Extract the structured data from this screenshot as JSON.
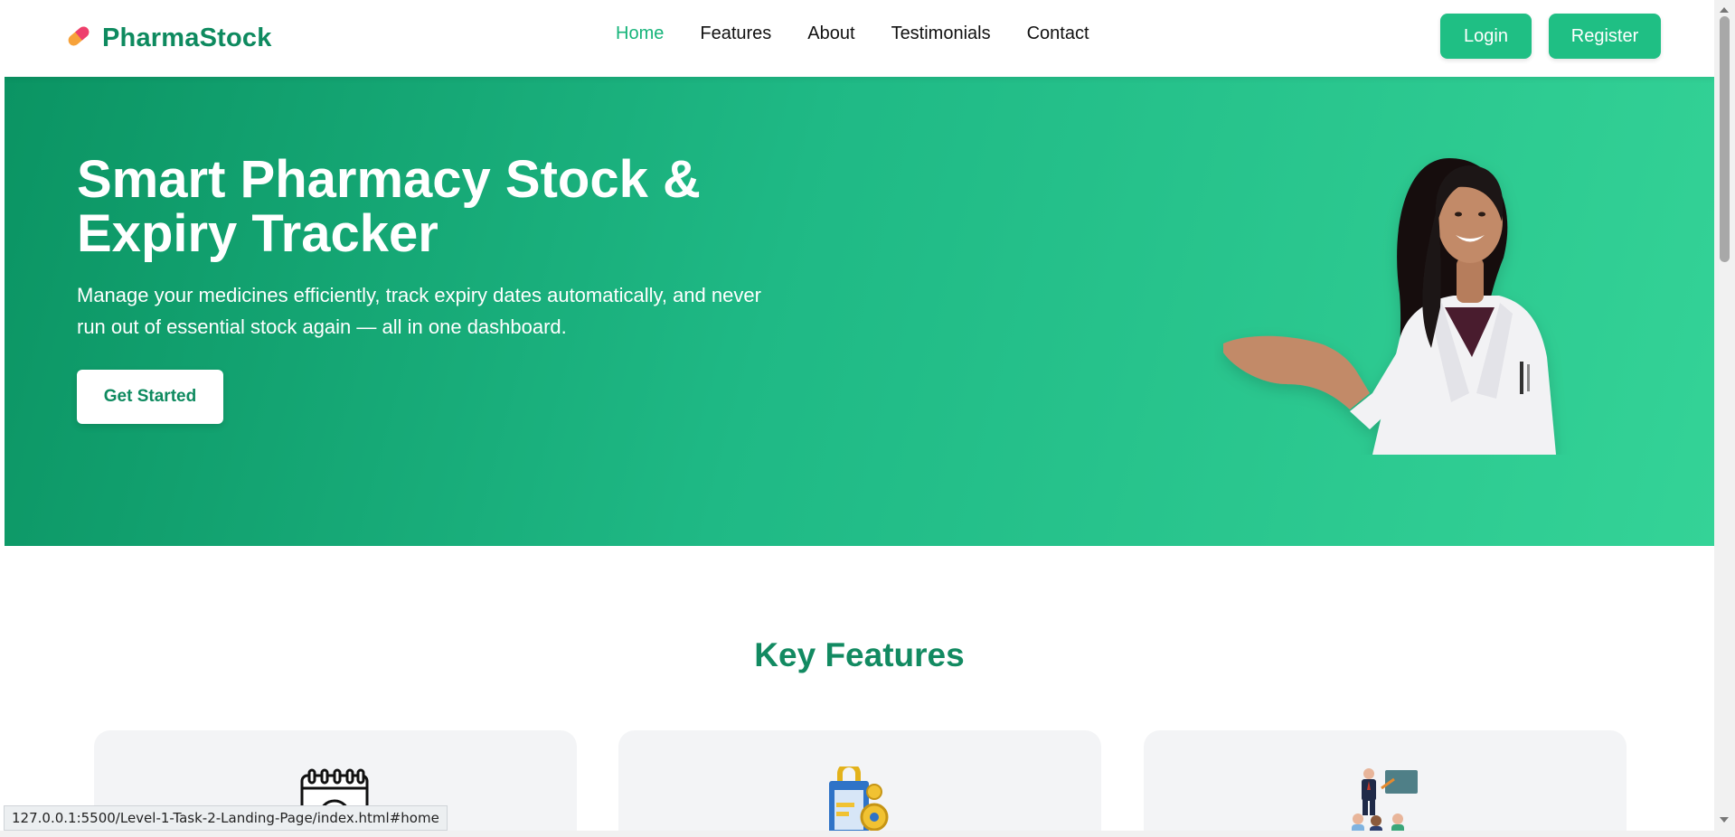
{
  "header": {
    "brand": "PharmaStock",
    "nav": [
      {
        "label": "Home",
        "active": true
      },
      {
        "label": "Features",
        "active": false
      },
      {
        "label": "About",
        "active": false
      },
      {
        "label": "Testimonials",
        "active": false
      },
      {
        "label": "Contact",
        "active": false
      }
    ],
    "login_label": "Login",
    "register_label": "Register"
  },
  "hero": {
    "title": "Smart Pharmacy Stock & Expiry Tracker",
    "subtitle": "Manage your medicines efficiently, track expiry dates automatically, and never run out of essential stock again — all in one dashboard.",
    "cta_label": "Get Started",
    "image": "pharmacist-presenting-illustration"
  },
  "features": {
    "title": "Key Features",
    "cards": [
      {
        "icon": "calendar-clock-icon"
      },
      {
        "icon": "clipboard-lock-gear-icon"
      },
      {
        "icon": "presentation-team-icon"
      }
    ]
  },
  "browser": {
    "status_url": "127.0.0.1:5500/Level-1-Task-2-Landing-Page/index.html#home"
  },
  "colors": {
    "brand": "#0e8a5f",
    "accent": "#1fbf84",
    "nav_active": "#16b47a",
    "hero_start": "#0b9463",
    "hero_end": "#34d397"
  }
}
